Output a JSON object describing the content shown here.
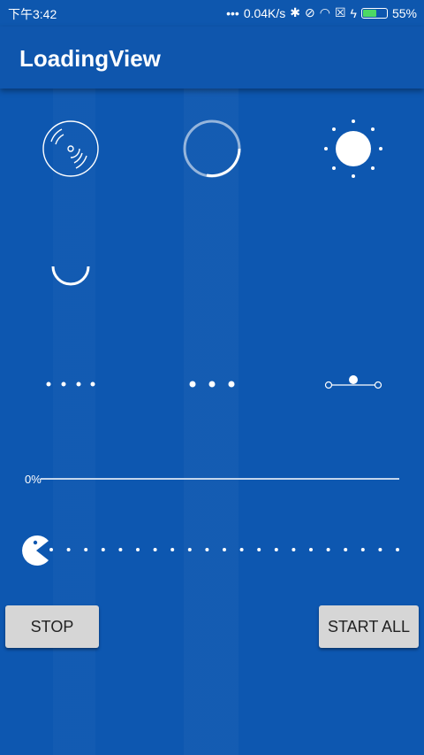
{
  "status_bar": {
    "time": "下午3:42",
    "network_speed": "0.04K/s",
    "battery": "55%"
  },
  "app_bar": {
    "title": "LoadingView"
  },
  "progress": {
    "label": "0%",
    "value": 0
  },
  "buttons": {
    "stop": "STOP",
    "start_all": "START ALL"
  },
  "colors": {
    "background": "#0d57b0",
    "foreground": "#ffffff",
    "button": "#d6d6d6"
  },
  "icons": [
    "disc-loader-icon",
    "circular-progress-icon",
    "sun-loader-icon",
    "smile-loader-icon",
    "dots-loader-icon",
    "three-dots-loader-icon",
    "node-line-loader-icon",
    "pacman-loader-icon"
  ]
}
